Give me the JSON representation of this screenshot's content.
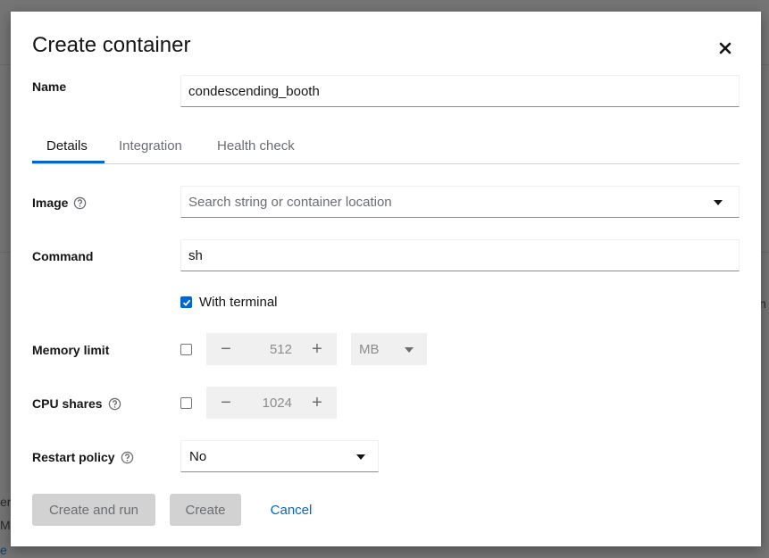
{
  "background": {
    "fragment_right": "n",
    "fragment_left_1": "er",
    "fragment_left_2": "ME",
    "fragment_left_link": "e"
  },
  "modal": {
    "title": "Create container",
    "close_icon": "close-icon",
    "name": {
      "label": "Name",
      "value": "condescending_booth"
    },
    "tabs": [
      {
        "label": "Details",
        "active": true
      },
      {
        "label": "Integration",
        "active": false
      },
      {
        "label": "Health check",
        "active": false
      }
    ],
    "image": {
      "label": "Image",
      "placeholder": "Search string or container location",
      "help_icon": "help-icon"
    },
    "command": {
      "label": "Command",
      "value": "sh"
    },
    "terminal": {
      "label": "With terminal",
      "checked": true
    },
    "memory": {
      "label": "Memory limit",
      "checked": false,
      "value": "512",
      "unit": "MB",
      "minus": "−",
      "plus": "+"
    },
    "cpu": {
      "label": "CPU shares",
      "checked": false,
      "value": "1024",
      "minus": "−",
      "plus": "+",
      "help_icon": "help-icon"
    },
    "restart": {
      "label": "Restart policy",
      "value": "No",
      "help_icon": "help-icon"
    },
    "buttons": {
      "create_and_run": "Create and run",
      "create": "Create",
      "cancel": "Cancel"
    }
  },
  "colors": {
    "accent": "#0066cc",
    "disabled_bg": "#d2d2d2",
    "disabled_text": "#6a6e73"
  }
}
